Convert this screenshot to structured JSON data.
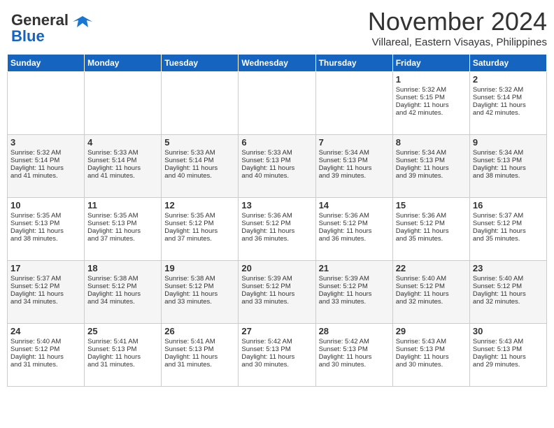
{
  "logo": {
    "line1": "General",
    "line2": "Blue"
  },
  "title": "November 2024",
  "location": "Villareal, Eastern Visayas, Philippines",
  "days_of_week": [
    "Sunday",
    "Monday",
    "Tuesday",
    "Wednesday",
    "Thursday",
    "Friday",
    "Saturday"
  ],
  "weeks": [
    [
      {
        "day": "",
        "info": ""
      },
      {
        "day": "",
        "info": ""
      },
      {
        "day": "",
        "info": ""
      },
      {
        "day": "",
        "info": ""
      },
      {
        "day": "",
        "info": ""
      },
      {
        "day": "1",
        "info": "Sunrise: 5:32 AM\nSunset: 5:15 PM\nDaylight: 11 hours\nand 42 minutes."
      },
      {
        "day": "2",
        "info": "Sunrise: 5:32 AM\nSunset: 5:14 PM\nDaylight: 11 hours\nand 42 minutes."
      }
    ],
    [
      {
        "day": "3",
        "info": "Sunrise: 5:32 AM\nSunset: 5:14 PM\nDaylight: 11 hours\nand 41 minutes."
      },
      {
        "day": "4",
        "info": "Sunrise: 5:33 AM\nSunset: 5:14 PM\nDaylight: 11 hours\nand 41 minutes."
      },
      {
        "day": "5",
        "info": "Sunrise: 5:33 AM\nSunset: 5:14 PM\nDaylight: 11 hours\nand 40 minutes."
      },
      {
        "day": "6",
        "info": "Sunrise: 5:33 AM\nSunset: 5:13 PM\nDaylight: 11 hours\nand 40 minutes."
      },
      {
        "day": "7",
        "info": "Sunrise: 5:34 AM\nSunset: 5:13 PM\nDaylight: 11 hours\nand 39 minutes."
      },
      {
        "day": "8",
        "info": "Sunrise: 5:34 AM\nSunset: 5:13 PM\nDaylight: 11 hours\nand 39 minutes."
      },
      {
        "day": "9",
        "info": "Sunrise: 5:34 AM\nSunset: 5:13 PM\nDaylight: 11 hours\nand 38 minutes."
      }
    ],
    [
      {
        "day": "10",
        "info": "Sunrise: 5:35 AM\nSunset: 5:13 PM\nDaylight: 11 hours\nand 38 minutes."
      },
      {
        "day": "11",
        "info": "Sunrise: 5:35 AM\nSunset: 5:13 PM\nDaylight: 11 hours\nand 37 minutes."
      },
      {
        "day": "12",
        "info": "Sunrise: 5:35 AM\nSunset: 5:12 PM\nDaylight: 11 hours\nand 37 minutes."
      },
      {
        "day": "13",
        "info": "Sunrise: 5:36 AM\nSunset: 5:12 PM\nDaylight: 11 hours\nand 36 minutes."
      },
      {
        "day": "14",
        "info": "Sunrise: 5:36 AM\nSunset: 5:12 PM\nDaylight: 11 hours\nand 36 minutes."
      },
      {
        "day": "15",
        "info": "Sunrise: 5:36 AM\nSunset: 5:12 PM\nDaylight: 11 hours\nand 35 minutes."
      },
      {
        "day": "16",
        "info": "Sunrise: 5:37 AM\nSunset: 5:12 PM\nDaylight: 11 hours\nand 35 minutes."
      }
    ],
    [
      {
        "day": "17",
        "info": "Sunrise: 5:37 AM\nSunset: 5:12 PM\nDaylight: 11 hours\nand 34 minutes."
      },
      {
        "day": "18",
        "info": "Sunrise: 5:38 AM\nSunset: 5:12 PM\nDaylight: 11 hours\nand 34 minutes."
      },
      {
        "day": "19",
        "info": "Sunrise: 5:38 AM\nSunset: 5:12 PM\nDaylight: 11 hours\nand 33 minutes."
      },
      {
        "day": "20",
        "info": "Sunrise: 5:39 AM\nSunset: 5:12 PM\nDaylight: 11 hours\nand 33 minutes."
      },
      {
        "day": "21",
        "info": "Sunrise: 5:39 AM\nSunset: 5:12 PM\nDaylight: 11 hours\nand 33 minutes."
      },
      {
        "day": "22",
        "info": "Sunrise: 5:40 AM\nSunset: 5:12 PM\nDaylight: 11 hours\nand 32 minutes."
      },
      {
        "day": "23",
        "info": "Sunrise: 5:40 AM\nSunset: 5:12 PM\nDaylight: 11 hours\nand 32 minutes."
      }
    ],
    [
      {
        "day": "24",
        "info": "Sunrise: 5:40 AM\nSunset: 5:12 PM\nDaylight: 11 hours\nand 31 minutes."
      },
      {
        "day": "25",
        "info": "Sunrise: 5:41 AM\nSunset: 5:13 PM\nDaylight: 11 hours\nand 31 minutes."
      },
      {
        "day": "26",
        "info": "Sunrise: 5:41 AM\nSunset: 5:13 PM\nDaylight: 11 hours\nand 31 minutes."
      },
      {
        "day": "27",
        "info": "Sunrise: 5:42 AM\nSunset: 5:13 PM\nDaylight: 11 hours\nand 30 minutes."
      },
      {
        "day": "28",
        "info": "Sunrise: 5:42 AM\nSunset: 5:13 PM\nDaylight: 11 hours\nand 30 minutes."
      },
      {
        "day": "29",
        "info": "Sunrise: 5:43 AM\nSunset: 5:13 PM\nDaylight: 11 hours\nand 30 minutes."
      },
      {
        "day": "30",
        "info": "Sunrise: 5:43 AM\nSunset: 5:13 PM\nDaylight: 11 hours\nand 29 minutes."
      }
    ]
  ]
}
